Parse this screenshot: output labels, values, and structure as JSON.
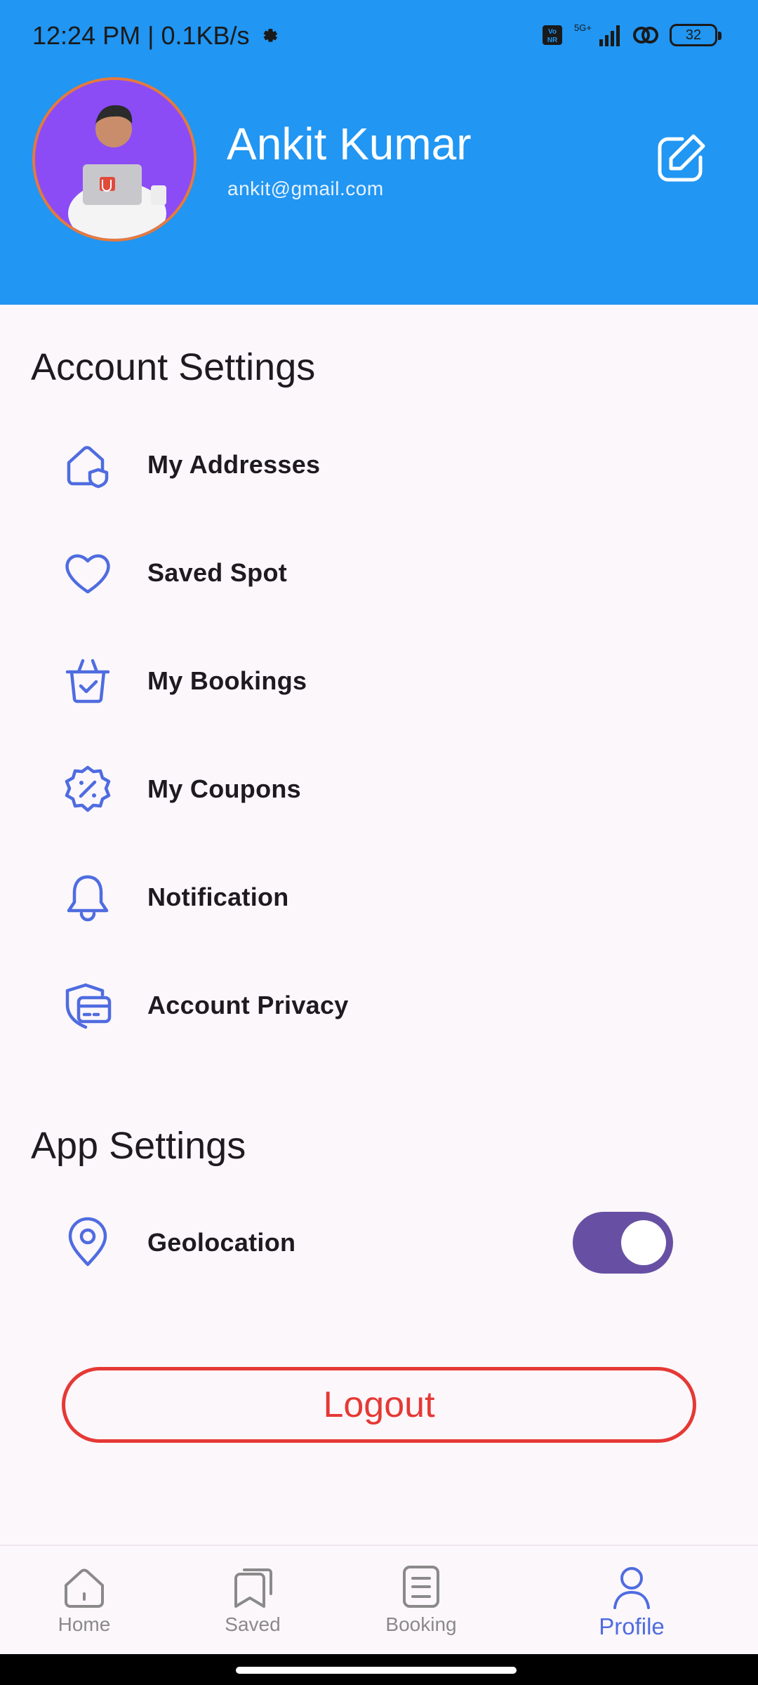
{
  "status_bar": {
    "time_speed": "12:24 PM | 0.1KB/s",
    "network": "5G+",
    "volte": "Vo NR",
    "battery": "32"
  },
  "profile": {
    "name": "Ankit Kumar",
    "email": "ankit@gmail.com"
  },
  "account_settings": {
    "title": "Account Settings",
    "items": [
      {
        "label": "My Addresses",
        "icon": "home-shield-icon"
      },
      {
        "label": "Saved Spot",
        "icon": "heart-icon"
      },
      {
        "label": "My Bookings",
        "icon": "basket-check-icon"
      },
      {
        "label": "My Coupons",
        "icon": "discount-badge-icon"
      },
      {
        "label": "Notification",
        "icon": "bell-icon"
      },
      {
        "label": "Account Privacy",
        "icon": "shield-card-icon"
      }
    ]
  },
  "app_settings": {
    "title": "App Settings",
    "geolocation": {
      "label": "Geolocation",
      "enabled": true
    }
  },
  "logout_label": "Logout",
  "bottom_nav": [
    {
      "label": "Home",
      "icon": "home-icon"
    },
    {
      "label": "Saved",
      "icon": "saved-icon"
    },
    {
      "label": "Booking",
      "icon": "booking-icon"
    },
    {
      "label": "Profile",
      "icon": "profile-icon",
      "active": true
    }
  ],
  "colors": {
    "header": "#2196f3",
    "accent": "#4f6ce0",
    "toggle": "#6750a4",
    "logout": "#e53935"
  }
}
